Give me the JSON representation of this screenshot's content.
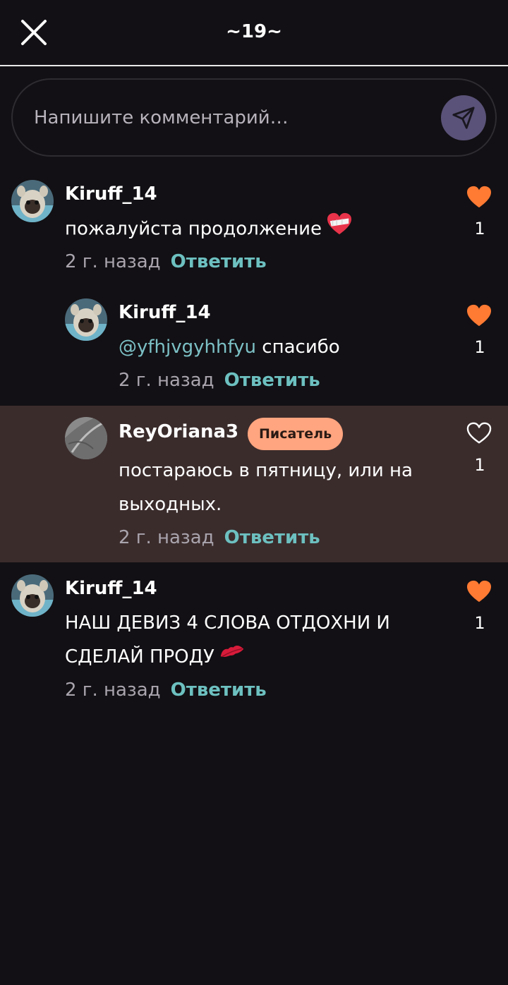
{
  "header": {
    "title": "~19~"
  },
  "composer": {
    "placeholder": "Напишите комментарий…"
  },
  "colors": {
    "accent_like": "#ff7a33",
    "reply_link": "#6dc0c0",
    "badge": "#ffa57f",
    "highlight_bg": "#3b2c2c",
    "send_button": "#5a5278"
  },
  "comments": [
    {
      "username": "Kiruff_14",
      "text": "пожалуйста продолжение",
      "emoji": "mending-heart-emoji",
      "time": "2 г. назад",
      "reply": "Ответить",
      "likes": "1",
      "liked": true
    },
    {
      "username": "Kiruff_14",
      "mention": "@yfhjvgyhhfyu",
      "text": " спасибо",
      "time": "2 г. назад",
      "reply": "Ответить",
      "likes": "1",
      "liked": true
    },
    {
      "username": "ReyOriana3",
      "badge": "Писатель",
      "text": "постараюсь в пятницу, или на выходных.",
      "time": "2 г. назад",
      "reply": "Ответить",
      "likes": "1",
      "liked": false
    },
    {
      "username": "Kiruff_14",
      "text": "НАШ ДЕВИЗ 4 СЛОВА ОТДОХНИ И СДЕЛАЙ ПРОДУ",
      "emoji": "kiss-mark-emoji",
      "time": "2 г. назад",
      "reply": "Ответить",
      "likes": "1",
      "liked": true
    }
  ]
}
